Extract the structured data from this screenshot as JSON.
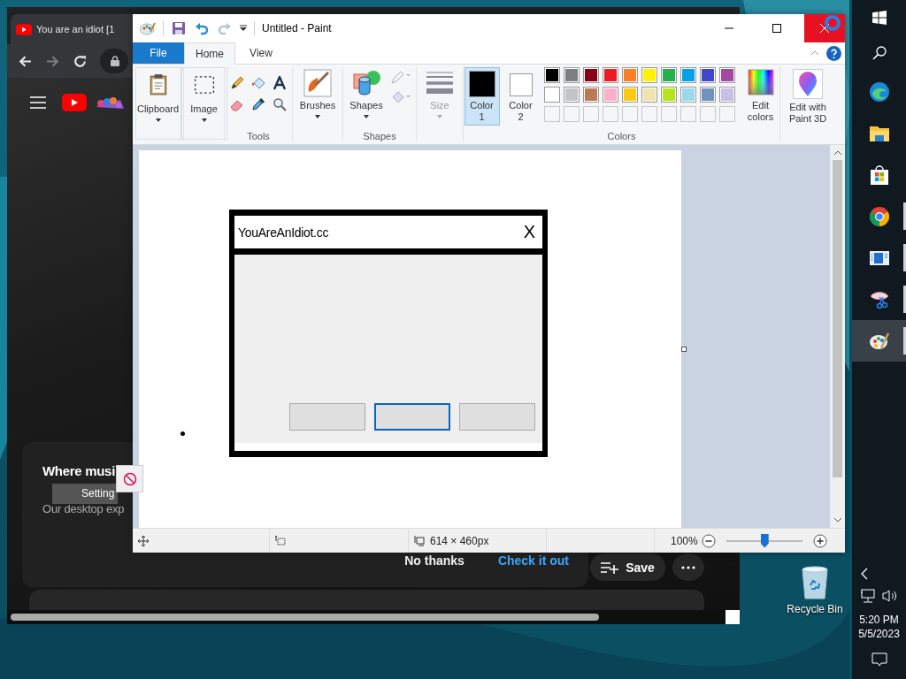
{
  "browser": {
    "tab_title": "You are an idiot [1",
    "promo": {
      "title": "Where musi",
      "tooltip": "Setting",
      "body": "Our desktop exp",
      "buttons": [
        {
          "label": "No thanks",
          "kind": "plain"
        },
        {
          "label": "Check it out",
          "kind": "link"
        }
      ]
    },
    "save_label": "Save"
  },
  "paint": {
    "title": "Untitled - Paint",
    "tabs": [
      {
        "label": "File",
        "kind": "file",
        "selected": false
      },
      {
        "label": "Home",
        "kind": "tab",
        "selected": true
      },
      {
        "label": "View",
        "kind": "tab",
        "selected": false
      }
    ],
    "groups": {
      "clipboard": "Clipboard",
      "image": "Image",
      "tools": "Tools",
      "brushes": "Brushes",
      "shapes_button": "Shapes",
      "shapes": "Shapes",
      "size": "Size",
      "colors": "Colors",
      "edit_colors": "Edit colors",
      "paint3d": "Edit with Paint 3D"
    },
    "color_slots": [
      {
        "label": "Color 1",
        "color": "#000000",
        "selected": true
      },
      {
        "label": "Color 2",
        "color": "#ffffff",
        "selected": false
      }
    ],
    "palette": [
      {
        "color": "#000000"
      },
      {
        "color": "#7f7f7f"
      },
      {
        "color": "#880015"
      },
      {
        "color": "#ed1c24"
      },
      {
        "color": "#ff7f27"
      },
      {
        "color": "#fff200"
      },
      {
        "color": "#22b14c"
      },
      {
        "color": "#00a2e8"
      },
      {
        "color": "#3f48cc"
      },
      {
        "color": "#a349a4"
      },
      {
        "color": "#ffffff"
      },
      {
        "color": "#c3c3c3"
      },
      {
        "color": "#b97a57"
      },
      {
        "color": "#ffaec9"
      },
      {
        "color": "#ffc90e"
      },
      {
        "color": "#efe4b0"
      },
      {
        "color": "#b5e61d"
      },
      {
        "color": "#99d9ea"
      },
      {
        "color": "#7092be"
      },
      {
        "color": "#c8bfe7"
      }
    ],
    "drawing": {
      "title": "YouAreAnIdiot.cc",
      "close": "X",
      "buttons": [
        {
          "selected": false
        },
        {
          "selected": true
        },
        {
          "selected": false
        }
      ]
    },
    "status": {
      "size": "614 × 460px",
      "zoom": "100%",
      "zoom_slider": {
        "level": 0.5
      }
    }
  },
  "desktop": {
    "icon_label": "Recycle Bin"
  },
  "taskbar": {
    "apps": [
      {
        "kind": "edge",
        "selected": false,
        "running": false
      },
      {
        "kind": "explorer",
        "selected": false,
        "running": false
      },
      {
        "kind": "store",
        "selected": false,
        "running": false
      },
      {
        "kind": "chrome",
        "selected": false,
        "running": true
      },
      {
        "kind": "app",
        "selected": false,
        "running": true
      },
      {
        "kind": "snip",
        "selected": false,
        "running": true
      },
      {
        "kind": "paint",
        "selected": true,
        "running": true
      }
    ],
    "time": "5:20 PM",
    "date": "5/5/2023"
  }
}
